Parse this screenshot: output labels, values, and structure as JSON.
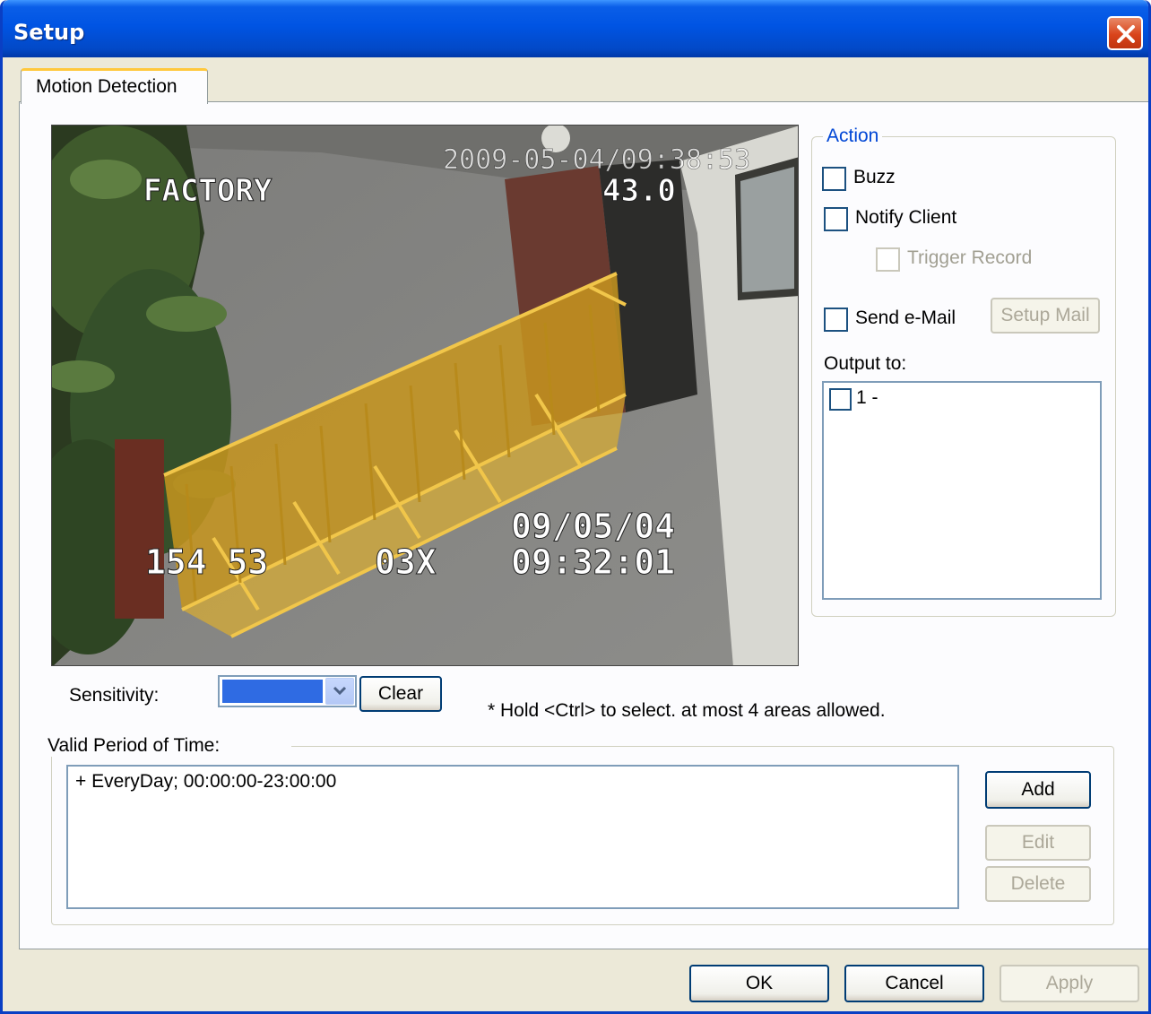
{
  "window": {
    "title": "Setup"
  },
  "tabs": [
    {
      "label": "Motion Detection"
    }
  ],
  "video": {
    "overlay_datetime_top": "2009-05-04/09:38:53",
    "overlay_location": "FACTORY",
    "overlay_zoom_value": "43.0",
    "overlay_coords": "154 53",
    "overlay_zoom": "03X",
    "overlay_date": "09/05/04",
    "overlay_time": "09:32:01"
  },
  "action": {
    "legend": "Action",
    "buzz_label": "Buzz",
    "notify_client_label": "Notify Client",
    "trigger_record_label": "Trigger Record",
    "send_email_label": "Send e-Mail",
    "setup_mail_label": "Setup Mail",
    "output_to_label": "Output to:",
    "outputs": [
      {
        "label": "1 -"
      }
    ]
  },
  "sensitivity": {
    "label": "Sensitivity:",
    "clear_label": "Clear",
    "hint": "* Hold <Ctrl> to select. at most 4 areas allowed."
  },
  "period": {
    "label": "Valid Period of Time:",
    "items": [
      "+ EveryDay; 00:00:00-23:00:00"
    ],
    "add_label": "Add",
    "edit_label": "Edit",
    "delete_label": "Delete"
  },
  "footer": {
    "ok_label": "OK",
    "cancel_label": "Cancel",
    "apply_label": "Apply"
  },
  "colors": {
    "title_bar": "#0054e3",
    "accent_blue": "#0046d5",
    "selection": "#2f6be3",
    "tab_highlight": "#ffc83c",
    "fence_yellow": "#e2b02a"
  }
}
